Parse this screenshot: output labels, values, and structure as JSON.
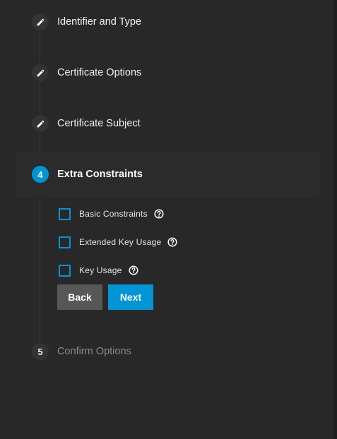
{
  "stepper": {
    "steps": [
      {
        "label": "Identifier and Type",
        "icon": "pencil-icon",
        "state": "completed"
      },
      {
        "label": "Certificate Options",
        "icon": "pencil-icon",
        "state": "completed"
      },
      {
        "label": "Certificate Subject",
        "icon": "pencil-icon",
        "state": "completed"
      },
      {
        "number": "4",
        "label": "Extra Constraints",
        "state": "active"
      },
      {
        "number": "5",
        "label": "Confirm Options",
        "state": "disabled"
      }
    ]
  },
  "extra_constraints": {
    "options": [
      {
        "label": "Basic Constraints",
        "checked": false,
        "help_icon": "help-circle-icon"
      },
      {
        "label": "Extended Key Usage",
        "checked": false,
        "help_icon": "help-circle-icon"
      },
      {
        "label": "Key Usage",
        "checked": false,
        "help_icon": "help-circle-icon"
      }
    ],
    "back_label": "Back",
    "next_label": "Next"
  },
  "colors": {
    "background": "#282828",
    "accent": "#0095d5",
    "step_circle": "#333333",
    "back_button": "#575757"
  }
}
